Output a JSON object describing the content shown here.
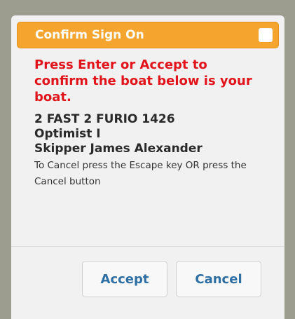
{
  "dialog": {
    "title": "Confirm Sign On",
    "prompt": "Press Enter or Accept to confirm the boat below is your boat.",
    "boat_name": "2 FAST 2 FURIO 1426",
    "boat_class": "Optimist I",
    "skipper": "Skipper James Alexander",
    "instructions": "To Cancel press the Escape key OR press the Cancel button",
    "accept_label": "Accept",
    "cancel_label": "Cancel"
  },
  "colors": {
    "title_bar": "#f5a52d",
    "prompt_text": "#e1141b",
    "button_text": "#2d6ea3",
    "backdrop": "#9c9c8f"
  }
}
